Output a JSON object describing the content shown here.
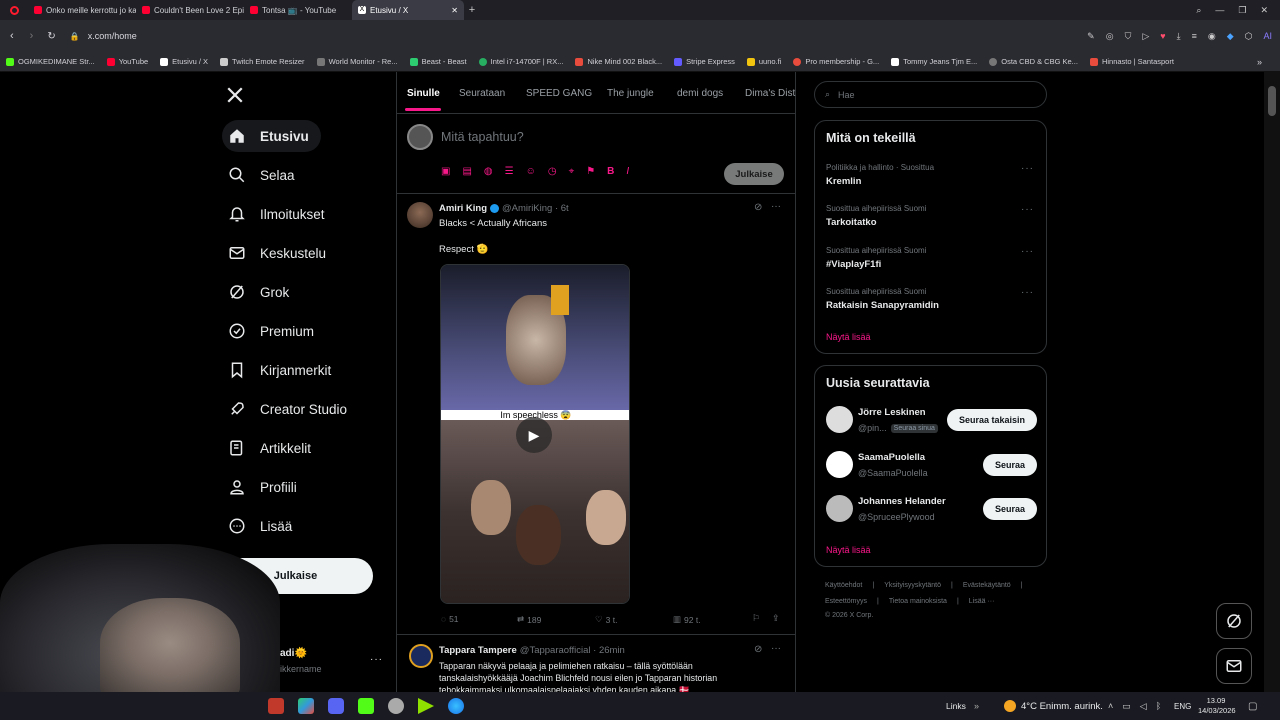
{
  "tabs": [
    {
      "label": "Onko meille kerrottu jo ka",
      "color": "#ff0033"
    },
    {
      "label": "Couldn't Been Love 2 Episo",
      "color": "#ff0033"
    },
    {
      "label": "Tontsa 📺 - YouTube",
      "color": "#ff0033"
    },
    {
      "label": "Etusivu / X",
      "color": "#ffffff"
    }
  ],
  "url": "x.com/home",
  "bookmarks": [
    "OGMIKEDIMANE Str...",
    "YouTube",
    "Etusivu / X",
    "Twitch Emote Resizer",
    "World Monitor - Re...",
    "Beast - Beast",
    "Intel i7-14700F | RX...",
    "Nike Mind 002 Black...",
    "Stripe Express",
    "uuno.fi",
    "Pro membership - G...",
    "Tommy Jeans Tjm E...",
    "Osta CBD & CBG Ke...",
    "Hinnasto | Santasport"
  ],
  "nav": {
    "items": [
      "Etusivu",
      "Selaa",
      "Ilmoitukset",
      "Keskustelu",
      "Grok",
      "Premium",
      "Kirjanmerkit",
      "Creator Studio",
      "Artikkelit",
      "Profiili",
      "Lisää"
    ],
    "post_button": "Julkaise",
    "account_name": "adi🌞",
    "account_handle": "ikkername"
  },
  "feed": {
    "tabs": [
      "Sinulle",
      "Seurataan",
      "SPEED GANG",
      "The jungle",
      "demi dogs",
      "Dima's Dist"
    ],
    "compose_placeholder": "Mitä tapahtuu?",
    "compose_button": "Julkaise",
    "post1": {
      "name": "Amiri King",
      "handle": "@AmiriKing · 6t",
      "text": "Blacks < Actually Africans",
      "text2": "Respect 🫡",
      "caption": "Im speechless 😨",
      "replies": "51",
      "reposts": "189",
      "likes": "3 t.",
      "views": "92 t."
    },
    "post2": {
      "name": "Tappara Tampere",
      "handle": "@Tapparaofficial · 26min",
      "line1": "Tapparan näkyvä pelaaja ja pelimiehen ratkaisu – tällä syöttölään",
      "line2": "tanskalaishyökkääjä Joachim Blichfeld nousi eilen jo Tapparan historian",
      "line3": "tehokkaimmaksi ulkomaalaispelaajaksi yhden kauden aikana 🇩🇰"
    }
  },
  "search_placeholder": "Hae",
  "trends": {
    "title": "Mitä on tekeillä",
    "items": [
      {
        "cat": "Politiikka ja hallinto · Suosittua",
        "name": "Kremlin"
      },
      {
        "cat": "Suosittua aihepiirissä Suomi",
        "name": "Tarkoitatko"
      },
      {
        "cat": "Suosittua aihepiirissä Suomi",
        "name": "#ViaplayF1fi"
      },
      {
        "cat": "Suosittua aihepiirissä Suomi",
        "name": "Ratkaisin Sanapyramidin"
      }
    ],
    "more": "Näytä lisää"
  },
  "follow": {
    "title": "Uusia seurattavia",
    "items": [
      {
        "name": "Jörre Leskinen",
        "handle": "@pin...",
        "badge": "Seuraa sinua",
        "button": "Seuraa takaisin"
      },
      {
        "name": "SaamaPuolella",
        "handle": "@SaamaPuolella",
        "button": "Seuraa"
      },
      {
        "name": "Johannes Helander",
        "handle": "@SpruceePlywood",
        "button": "Seuraa"
      }
    ],
    "more": "Näytä lisää"
  },
  "footer": {
    "l1": [
      "Käyttöehdot",
      "Yksityisyyskytäntö",
      "Evästekäytäntö"
    ],
    "l2": [
      "Esteettömyys",
      "Tietoa mainoksista",
      "Lisää ···"
    ],
    "copy": "© 2026 X Corp."
  },
  "taskbar": {
    "links": "Links",
    "weather": "4°C  Enimm. aurink.",
    "lang": "ENG",
    "time": "13.09",
    "date": "14/03/2026"
  }
}
